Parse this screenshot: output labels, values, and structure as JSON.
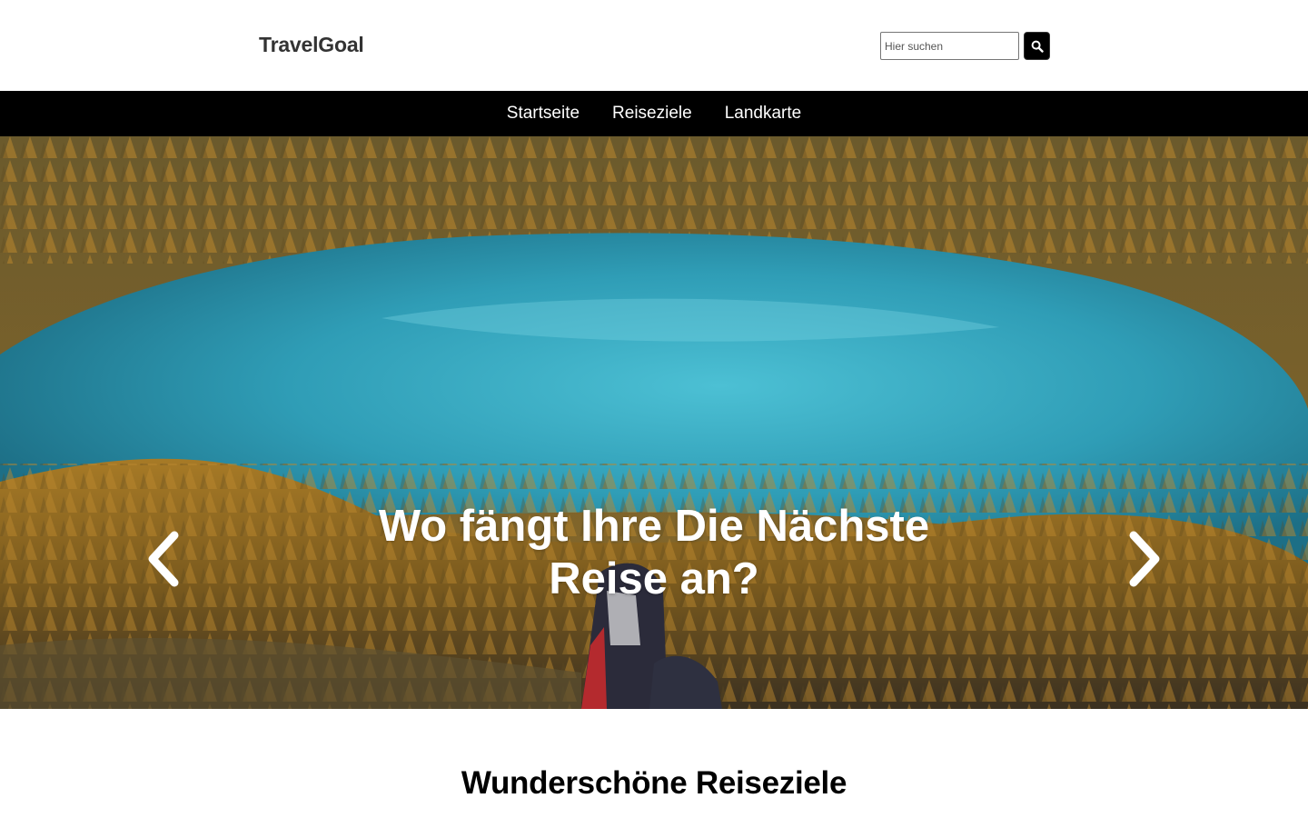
{
  "header": {
    "logo": "TravelGoal",
    "search": {
      "placeholder": "Hier suchen",
      "value": ""
    },
    "search_button_icon": "search-icon"
  },
  "nav": {
    "items": [
      {
        "label": "Startseite"
      },
      {
        "label": "Reiseziele"
      },
      {
        "label": "Landkarte"
      }
    ]
  },
  "hero": {
    "title": "Wo fängt Ihre Die Nächste Reise an?",
    "prev_icon": "chevron-left-icon",
    "next_icon": "chevron-right-icon",
    "image": "lake surrounded by autumn larch forest, sneakers in foreground"
  },
  "section": {
    "title": "Wunderschöne Reiseziele"
  },
  "colors": {
    "nav_bg": "#000000",
    "logo": "#333333",
    "water": "#3aa9c0",
    "forest": "#b8862e"
  }
}
